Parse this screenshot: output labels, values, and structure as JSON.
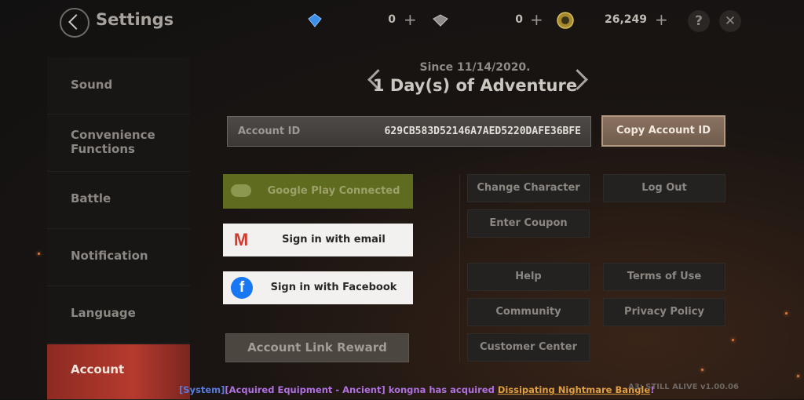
{
  "header": {
    "title": "Settings",
    "currencies": [
      {
        "icon": "blue-diamond-icon",
        "value": "0"
      },
      {
        "icon": "silver-diamond-icon",
        "value": "0"
      },
      {
        "icon": "gold-coin-icon",
        "value": "26,249"
      }
    ],
    "plus_label": "+",
    "help_label": "?",
    "close_label": "✕"
  },
  "sidebar": {
    "items": [
      {
        "label": "Sound"
      },
      {
        "label": "Convenience Functions"
      },
      {
        "label": "Battle"
      },
      {
        "label": "Notification"
      },
      {
        "label": "Language"
      },
      {
        "label": "Account",
        "active": true
      }
    ]
  },
  "account": {
    "since": "Since 11/14/2020.",
    "adventure": "1 Day(s) of Adventure",
    "id_label": "Account ID",
    "id_value": "629CB583D52146A7AED5220DAFE36BFE",
    "copy_label": "Copy Account ID",
    "google_label": "Google Play Connected",
    "email_label": "Sign in with email",
    "facebook_label": "Sign in with Facebook",
    "reward_label": "Account Link Reward",
    "change_character": "Change Character",
    "logout": "Log Out",
    "enter_coupon": "Enter Coupon",
    "help": "Help",
    "terms": "Terms of Use",
    "community": "Community",
    "privacy": "Privacy Policy",
    "customer_center": "Customer Center"
  },
  "system_message": {
    "prefix": "[System]",
    "category": "[Acquired Equipment - Ancient]",
    "player_text": " kongna has acquired ",
    "item": "Dissipating Nightmare Bangle",
    "suffix": "!"
  },
  "version": "A3: STILL ALIVE v1.00.06",
  "colors": {
    "accent_active": "#b63a2e",
    "google": "#5f6b1f",
    "facebook": "#1877f2",
    "gmail": "#d03a2f",
    "system_blue": "#5b7bd8",
    "system_purple": "#b070e0",
    "item_orange": "#e0a040"
  }
}
